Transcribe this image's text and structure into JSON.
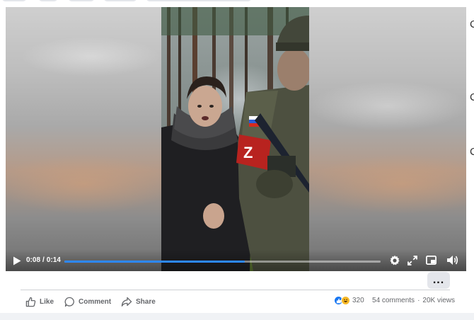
{
  "player": {
    "current_time": "0:08",
    "time_separator": "/",
    "duration": "0:14",
    "progress": 0.57,
    "progress_color": "#2d88ff",
    "controls": [
      "play-icon",
      "gear-icon",
      "fullscreen-icon",
      "pip-icon",
      "volume-icon"
    ]
  },
  "video": {
    "armband_letter": "Z"
  },
  "more_button": {
    "label": "..."
  },
  "actions": {
    "like_label": "Like",
    "comment_label": "Comment",
    "share_label": "Share"
  },
  "stats": {
    "reaction_count": "320",
    "comments": "54 comments",
    "views": "20K views",
    "separator": "·",
    "reaction_icons": [
      "like-reaction",
      "haha-reaction"
    ]
  },
  "edge_glyphs": [
    "C",
    "C",
    "C"
  ],
  "colors": {
    "accent": "#1877f2",
    "text_secondary": "#65676b",
    "button_bg": "#e4e6eb"
  }
}
